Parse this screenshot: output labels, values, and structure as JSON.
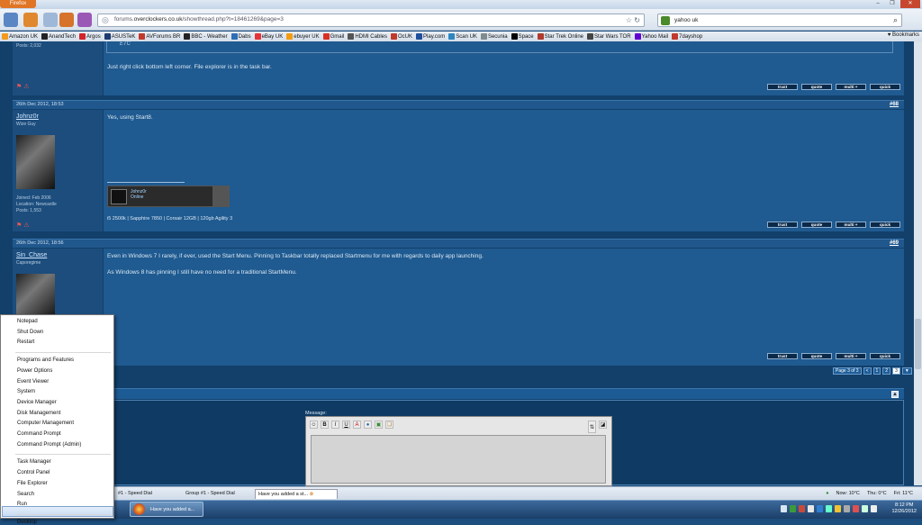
{
  "browser": {
    "menu_button": "Firefox",
    "window_controls": {
      "minimize": "–",
      "restore": "❐",
      "close": "✕"
    },
    "url_prefix": "forums.",
    "url_domain": "overclockers.co.uk",
    "url_path": "/showthread.php?t=18461269&page=3",
    "search_value": "yahoo uk",
    "bookmarks_label": "Bookmarks",
    "bookmarks": [
      {
        "label": "Amazon UK",
        "color": "#f29b1d"
      },
      {
        "label": "AnandTech",
        "color": "#222222"
      },
      {
        "label": "Argos",
        "color": "#d2232a"
      },
      {
        "label": "ASUSTeK",
        "color": "#1c3b6f"
      },
      {
        "label": "AVForums BR",
        "color": "#c0392b"
      },
      {
        "label": "BBC - Weather",
        "color": "#222222"
      },
      {
        "label": "Dabs",
        "color": "#2f6db5"
      },
      {
        "label": "eBay UK",
        "color": "#e53238"
      },
      {
        "label": "ebuyer UK",
        "color": "#f39c12"
      },
      {
        "label": "Gmail",
        "color": "#d93025"
      },
      {
        "label": "HDMI Cables",
        "color": "#555555"
      },
      {
        "label": "OcUK",
        "color": "#c0392b"
      },
      {
        "label": "Play.com",
        "color": "#1f4f9c"
      },
      {
        "label": "Scan UK",
        "color": "#2e86c1"
      },
      {
        "label": "Secunia",
        "color": "#7f8c8d"
      },
      {
        "label": "Space",
        "color": "#000000"
      },
      {
        "label": "Star Trek Online",
        "color": "#b03a2e"
      },
      {
        "label": "Star Wars TOR",
        "color": "#444444"
      },
      {
        "label": "Yahoo Mail",
        "color": "#6001d2"
      },
      {
        "label": "7dayshop",
        "color": "#c0392b"
      }
    ]
  },
  "posts": [
    {
      "user_info": "Posts: 2,032",
      "quote_text": "ETC",
      "text": "Just right click bottom left corner. File explorer is in the task bar."
    },
    {
      "date": "26th Dec 2012, 18:53",
      "number": "#68",
      "username": "Johnz0r",
      "user_title": "Wize Guy",
      "user_info": [
        "Joined: Feb 2006",
        "Location: Newcastle",
        "Posts: 1,553"
      ],
      "text": "Yes, using Start8.",
      "sig_name": "Johnz0r",
      "sig_status": "Online",
      "sig_text": "i5 2500k | Sapphire 7850 | Corsair 12GB | 120gb Agility 3"
    },
    {
      "date": "26th Dec 2012, 18:56",
      "number": "#69",
      "username": "Sin_Chase",
      "user_title": "Caporegime",
      "text1": "Even in Windows 7 I rarely, if ever, used the Start Menu. Pinning to Taskbar totally replaced Startmenu for me with regards to daily app launching.",
      "text2": "As Windows 8 has pinning I still have no need for a traditional StartMenu."
    }
  ],
  "post_buttons": [
    "trust",
    "quote",
    "multi +",
    "quick"
  ],
  "pagenav": {
    "label": "Page 3 of 3",
    "items": [
      "<",
      "1",
      "2",
      "3",
      "▼"
    ]
  },
  "quick_reply": {
    "message_label": "Message:",
    "collapse": "▲"
  },
  "editor_tools": [
    "☺",
    "B",
    "I",
    "U",
    "A",
    "●",
    "▣",
    "❏",
    "⇅",
    "◪"
  ],
  "winx_menu": [
    {
      "label": "Notepad",
      "group": 0
    },
    {
      "label": "Shut Down",
      "group": 0
    },
    {
      "label": "Restart",
      "group": 0
    },
    {
      "label": "Programs and Features",
      "group": 1
    },
    {
      "label": "Power Options",
      "group": 1
    },
    {
      "label": "Event Viewer",
      "group": 1
    },
    {
      "label": "System",
      "group": 1
    },
    {
      "label": "Device Manager",
      "group": 1
    },
    {
      "label": "Disk Management",
      "group": 1
    },
    {
      "label": "Computer Management",
      "group": 1
    },
    {
      "label": "Command Prompt",
      "group": 1
    },
    {
      "label": "Command Prompt (Admin)",
      "group": 1
    },
    {
      "label": "Task Manager",
      "group": 2
    },
    {
      "label": "Control Panel",
      "group": 2
    },
    {
      "label": "File Explorer",
      "group": 2
    },
    {
      "label": "Search",
      "group": 2
    },
    {
      "label": "Run",
      "group": 2
    },
    {
      "label": "Desktop",
      "group": 3
    }
  ],
  "status_tabs": [
    "#1 - Speed Dial",
    "Group #1 - Speed Dial",
    "Have you added a st..."
  ],
  "weather": {
    "now": "Now: 10°C",
    "thu": "Thu: 0°C",
    "fri": "Fri: 11°C"
  },
  "taskbar": {
    "task_label": "Have you added a...",
    "time": "8:12 PM",
    "date": "12/26/2012"
  }
}
